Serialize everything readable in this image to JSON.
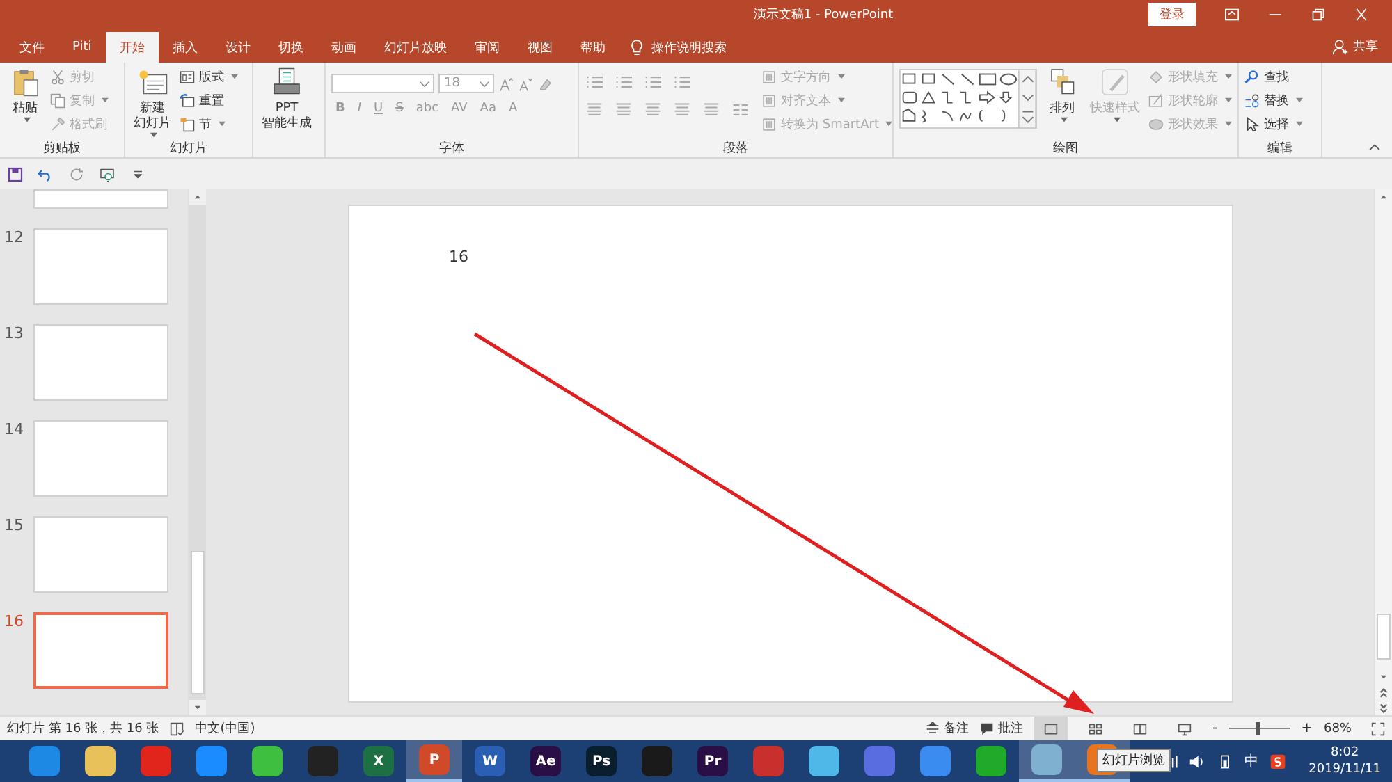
{
  "window": {
    "title": "演示文稿1  -  PowerPoint",
    "login": "登录"
  },
  "tabs": [
    {
      "label": "文件",
      "selected": false
    },
    {
      "label": "Piti",
      "selected": false
    },
    {
      "label": "开始",
      "selected": true
    },
    {
      "label": "插入",
      "selected": false
    },
    {
      "label": "设计",
      "selected": false
    },
    {
      "label": "切换",
      "selected": false
    },
    {
      "label": "动画",
      "selected": false
    },
    {
      "label": "幻灯片放映",
      "selected": false
    },
    {
      "label": "审阅",
      "selected": false
    },
    {
      "label": "视图",
      "selected": false
    },
    {
      "label": "帮助",
      "selected": false
    }
  ],
  "tell_me": "操作说明搜索",
  "share": "共享",
  "ribbon": [
    {
      "kind": "clipboard",
      "label": "剪贴板",
      "large_buttons": [
        {
          "lines": [
            "粘贴"
          ],
          "disabled": false,
          "dropdown": true
        }
      ],
      "small_buttons": [
        {
          "label": "剪切",
          "disabled": true,
          "dropdown": false
        },
        {
          "label": "复制",
          "disabled": true,
          "dropdown": true
        },
        {
          "label": "格式刷",
          "disabled": true,
          "dropdown": false
        }
      ]
    },
    {
      "kind": "slides",
      "label": "幻灯片",
      "large_buttons": [
        {
          "lines": [
            "新建",
            "幻灯片"
          ],
          "disabled": false,
          "dropdown": true
        }
      ],
      "small_buttons": [
        {
          "label": "版式",
          "disabled": false,
          "dropdown": true
        },
        {
          "label": "重置",
          "disabled": false,
          "dropdown": false
        },
        {
          "label": "节",
          "disabled": false,
          "dropdown": true
        }
      ]
    },
    {
      "kind": "ppt",
      "large_buttons": [
        {
          "lines": [
            "PPT",
            "智能生成"
          ],
          "disabled": false,
          "dropdown": false
        }
      ]
    },
    {
      "kind": "font",
      "label": "字体",
      "font_size": "18",
      "format_buttons": [
        "B",
        "I",
        "U",
        "S",
        "abc",
        "AV",
        "Aa",
        "A"
      ]
    },
    {
      "kind": "paragraph",
      "label": "段落",
      "small_buttons": [
        {
          "label": "文字方向",
          "disabled": true,
          "dropdown": true
        },
        {
          "label": "对齐文本",
          "disabled": true,
          "dropdown": true
        },
        {
          "label": "转换为 SmartArt",
          "disabled": true,
          "dropdown": true
        }
      ]
    },
    {
      "kind": "drawing",
      "label": "绘图",
      "large_buttons": [
        {
          "lines": [
            "排列"
          ],
          "disabled": false,
          "dropdown": true
        },
        {
          "lines": [
            "快速样式"
          ],
          "disabled": true,
          "dropdown": true
        }
      ],
      "small_buttons": [
        {
          "label": "形状填充",
          "disabled": true,
          "dropdown": true
        },
        {
          "label": "形状轮廓",
          "disabled": true,
          "dropdown": true
        },
        {
          "label": "形状效果",
          "disabled": true,
          "dropdown": true
        }
      ]
    },
    {
      "kind": "editing",
      "label": "编辑",
      "small_buttons": [
        {
          "label": "查找",
          "disabled": false,
          "dropdown": false
        },
        {
          "label": "替换",
          "disabled": false,
          "dropdown": true
        },
        {
          "label": "选择",
          "disabled": false,
          "dropdown": true
        }
      ]
    }
  ],
  "thumbnails": [
    {
      "partial": true,
      "selected": false
    },
    {
      "number": "12",
      "selected": false
    },
    {
      "number": "13",
      "selected": false
    },
    {
      "number": "14",
      "selected": false
    },
    {
      "number": "15",
      "selected": false
    },
    {
      "number": "16",
      "selected": true
    }
  ],
  "slide": {
    "text": "16"
  },
  "status_bar": {
    "slide_info": "幻灯片 第 16 张，共 16 张",
    "language": "中文(中国)",
    "notes": "备注",
    "comments": "批注",
    "views": [
      {
        "selected": true
      },
      {
        "selected": false
      },
      {
        "selected": false
      },
      {
        "selected": false
      }
    ],
    "zoom_minus": "-",
    "zoom_plus": "+",
    "zoom": {
      "level": 0.45
    },
    "zoom_percent": "68%"
  },
  "taskbar": {
    "apps": [
      {
        "color": "#1e88e5",
        "active": false
      },
      {
        "color": "#e8c15a",
        "active": false
      },
      {
        "color": "#e0261c",
        "active": false
      },
      {
        "color": "#1a8cff",
        "active": false
      },
      {
        "color": "#3fbf3f",
        "active": false
      },
      {
        "color": "#222222",
        "active": false
      },
      {
        "color": "#1d7044",
        "glyph": "X",
        "active": false
      },
      {
        "color": "#d04a29",
        "glyph": "P",
        "active": true
      },
      {
        "color": "#2b5fb3",
        "glyph": "W",
        "active": false
      },
      {
        "color": "#2a0e46",
        "glyph": "Ae",
        "active": false
      },
      {
        "color": "#0a1f2e",
        "glyph": "Ps",
        "active": false
      },
      {
        "color": "#1a1a1a",
        "active": false
      },
      {
        "color": "#2a0e46",
        "glyph": "Pr",
        "active": false
      },
      {
        "color": "#c8302e",
        "active": false
      },
      {
        "color": "#4fb8e8",
        "active": false
      },
      {
        "color": "#5a6de0",
        "active": false
      },
      {
        "color": "#3a8cf0",
        "active": false
      },
      {
        "color": "#1faa2a",
        "active": false
      },
      {
        "color": "#7fb0d0",
        "active": true
      },
      {
        "color": "#e8741e",
        "active": true
      }
    ],
    "tooltip": "幻灯片浏览",
    "ime": "中",
    "time": "8:02",
    "date": "2019/11/11"
  }
}
